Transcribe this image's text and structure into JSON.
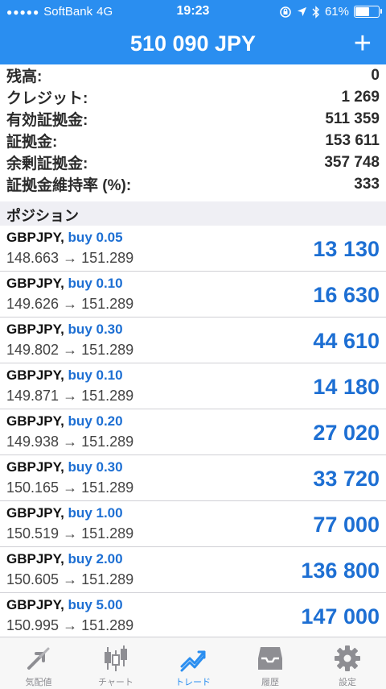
{
  "status_bar": {
    "carrier": "SoftBank",
    "network": "4G",
    "time": "19:23",
    "battery": "61%",
    "battery_level": 0.61
  },
  "header": {
    "title": "510 090 JPY",
    "add_label": "+"
  },
  "summary": [
    {
      "label": "残高:",
      "value": "0"
    },
    {
      "label": "クレジット:",
      "value": "1 269"
    },
    {
      "label": "有効証拠金:",
      "value": "511 359"
    },
    {
      "label": "証拠金:",
      "value": "153 611"
    },
    {
      "label": "余剰証拠金:",
      "value": "357 748"
    },
    {
      "label": "証拠金維持率 (%):",
      "value": "333"
    }
  ],
  "positions_section": {
    "title": "ポジション"
  },
  "positions": [
    {
      "symbol": "GBPJPY,",
      "side": "buy 0.05",
      "prices": "148.663 → 151.289",
      "profit": "13 130"
    },
    {
      "symbol": "GBPJPY,",
      "side": "buy 0.10",
      "prices": "149.626 → 151.289",
      "profit": "16 630"
    },
    {
      "symbol": "GBPJPY,",
      "side": "buy 0.30",
      "prices": "149.802 → 151.289",
      "profit": "44 610"
    },
    {
      "symbol": "GBPJPY,",
      "side": "buy 0.10",
      "prices": "149.871 → 151.289",
      "profit": "14 180"
    },
    {
      "symbol": "GBPJPY,",
      "side": "buy 0.20",
      "prices": "149.938 → 151.289",
      "profit": "27 020"
    },
    {
      "symbol": "GBPJPY,",
      "side": "buy 0.30",
      "prices": "150.165 → 151.289",
      "profit": "33 720"
    },
    {
      "symbol": "GBPJPY,",
      "side": "buy 1.00",
      "prices": "150.519 → 151.289",
      "profit": "77 000"
    },
    {
      "symbol": "GBPJPY,",
      "side": "buy 2.00",
      "prices": "150.605 → 151.289",
      "profit": "136 800"
    },
    {
      "symbol": "GBPJPY,",
      "side": "buy 5.00",
      "prices": "150.995 → 151.289",
      "profit": "147 000"
    }
  ],
  "tabs": [
    {
      "label": "気配値",
      "icon": "quotes-arrows-icon",
      "active": false
    },
    {
      "label": "チャート",
      "icon": "candlestick-chart-icon",
      "active": false
    },
    {
      "label": "トレード",
      "icon": "trade-trend-icon",
      "active": true
    },
    {
      "label": "履歴",
      "icon": "history-tray-icon",
      "active": false
    },
    {
      "label": "設定",
      "icon": "settings-gear-icon",
      "active": false
    }
  ],
  "colors": {
    "accent": "#2a8ef0",
    "profit": "#1d6fd3",
    "inactive_tab": "#8e8e93"
  }
}
